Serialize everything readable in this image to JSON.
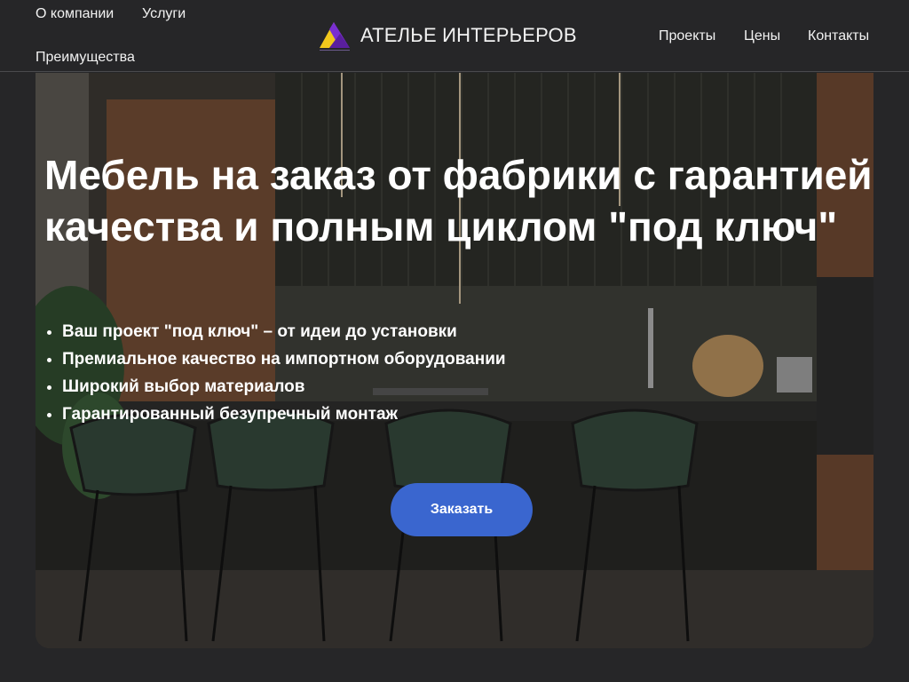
{
  "header": {
    "nav_left": [
      "О компании",
      "Услуги",
      "Преимущества"
    ],
    "brand_name": "АТЕЛЬЕ ИНТЕРЬЕРОВ",
    "nav_right": [
      "Проекты",
      "Цены",
      "Контакты"
    ]
  },
  "hero": {
    "title": "Мебель на заказ от фабрики с гарантией качества и полным циклом \"под ключ\"",
    "benefits": [
      "Ваш проект \"под ключ\" – от идеи до установки",
      "Премиальное качество на импортном оборудовании",
      "Широкий выбор материалов",
      "Гарантированный безупречный монтаж"
    ],
    "order_label": "Заказать",
    "background_icon": "kitchen-photo"
  },
  "colors": {
    "page_bg": "#262628",
    "accent": "#3a66cf",
    "text": "#ffffff",
    "logo_yellow": "#f2c81c",
    "logo_purple": "#7a2fd0"
  }
}
